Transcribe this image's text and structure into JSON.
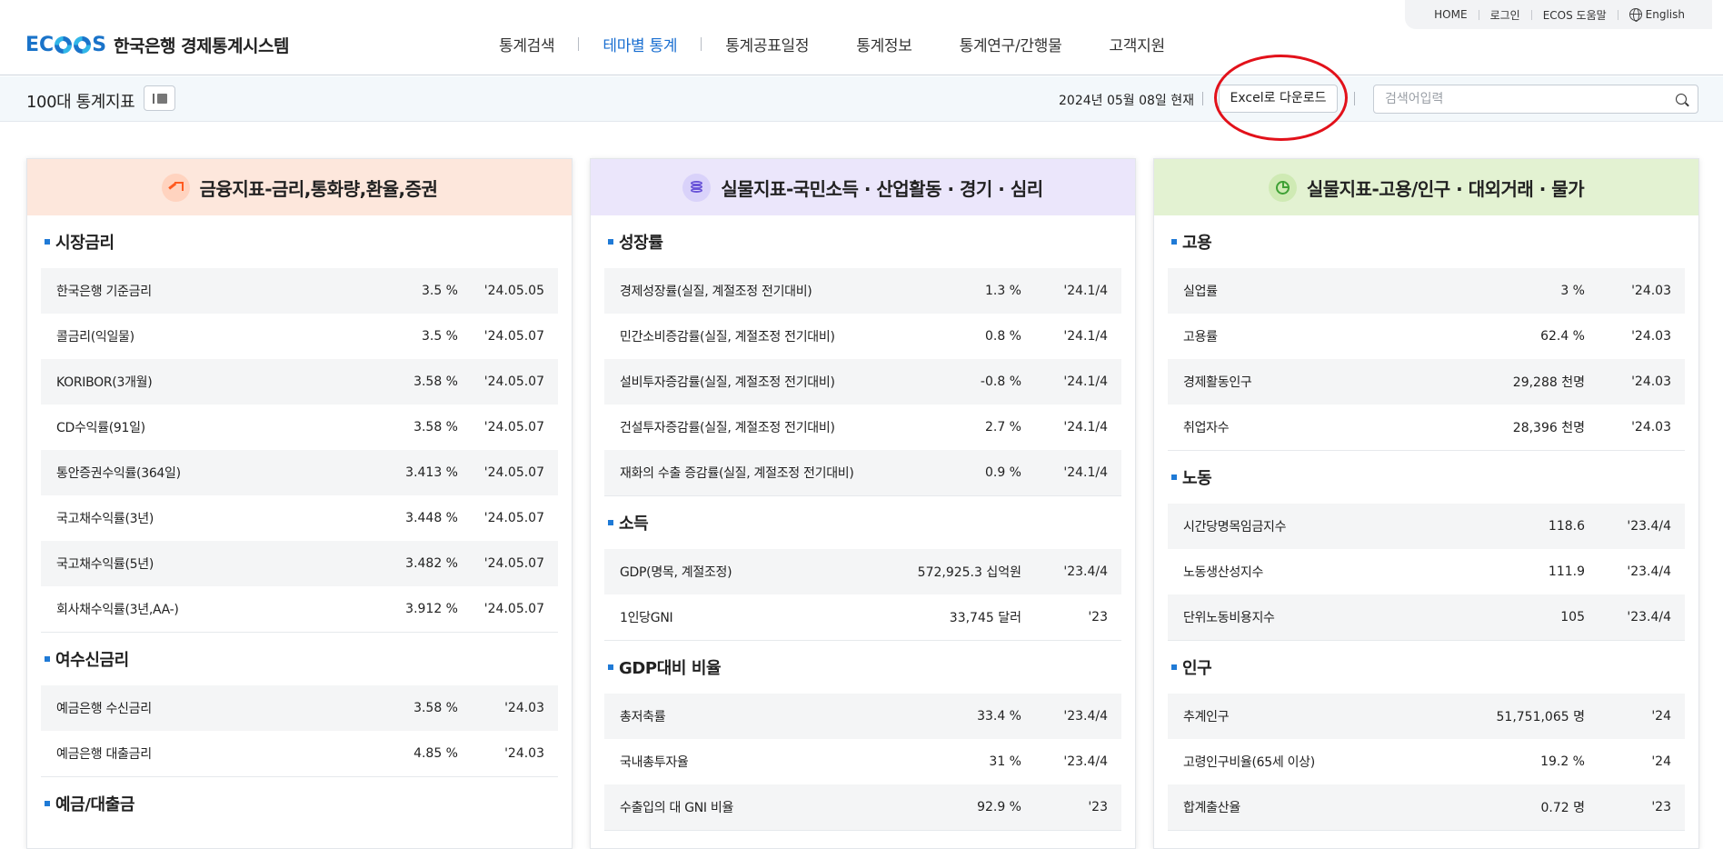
{
  "header": {
    "logo_mark": "ECOS",
    "logo_text": "한국은행 경제통계시스템",
    "util": [
      "HOME",
      "로그인",
      "ECOS 도움말",
      "English"
    ],
    "nav": [
      "통계검색",
      "테마별 통계",
      "통계공표일정",
      "통계정보",
      "통계연구/간행물",
      "고객지원"
    ],
    "active_nav": "테마별 통계"
  },
  "subbar": {
    "title": "100대 통계지표",
    "date": "2024년 05월 08일 현재",
    "excel_label": "Excel로 다운로드",
    "search_placeholder": "검색어입력"
  },
  "colors": {
    "accent": "#1a6fd1",
    "panel1_head": "#fde7dc",
    "panel2_head": "#ebe6fb",
    "panel3_head": "#e3f2d2",
    "highlight_circle": "#e2111a"
  },
  "panels": [
    {
      "title": "금융지표-금리,통화량,환율,증권",
      "icon": "trend-up-icon",
      "sections": [
        {
          "title": "시장금리",
          "rows": [
            {
              "name": "한국은행 기준금리",
              "value": "3.5 %",
              "date": "'24.05.05"
            },
            {
              "name": "콜금리(익일물)",
              "value": "3.5 %",
              "date": "'24.05.07"
            },
            {
              "name": "KORIBOR(3개월)",
              "value": "3.58 %",
              "date": "'24.05.07"
            },
            {
              "name": "CD수익률(91일)",
              "value": "3.58 %",
              "date": "'24.05.07"
            },
            {
              "name": "통안증권수익률(364일)",
              "value": "3.413 %",
              "date": "'24.05.07"
            },
            {
              "name": "국고채수익률(3년)",
              "value": "3.448 %",
              "date": "'24.05.07"
            },
            {
              "name": "국고채수익률(5년)",
              "value": "3.482 %",
              "date": "'24.05.07"
            },
            {
              "name": "회사채수익률(3년,AA-)",
              "value": "3.912 %",
              "date": "'24.05.07"
            }
          ]
        },
        {
          "title": "여수신금리",
          "rows": [
            {
              "name": "예금은행 수신금리",
              "value": "3.58 %",
              "date": "'24.03"
            },
            {
              "name": "예금은행 대출금리",
              "value": "4.85 %",
              "date": "'24.03"
            }
          ]
        },
        {
          "title": "예금/대출금",
          "rows": []
        }
      ]
    },
    {
      "title": "실물지표-국민소득 · 산업활동 · 경기 · 심리",
      "icon": "coins-icon",
      "sections": [
        {
          "title": "성장률",
          "rows": [
            {
              "name": "경제성장률(실질, 계절조정 전기대비)",
              "value": "1.3 %",
              "date": "'24.1/4"
            },
            {
              "name": "민간소비증감률(실질, 계절조정 전기대비)",
              "value": "0.8 %",
              "date": "'24.1/4"
            },
            {
              "name": "설비투자증감률(실질, 계절조정 전기대비)",
              "value": "-0.8 %",
              "date": "'24.1/4"
            },
            {
              "name": "건설투자증감률(실질, 계절조정 전기대비)",
              "value": "2.7 %",
              "date": "'24.1/4"
            },
            {
              "name": "재화의 수출 증감률(실질, 계절조정 전기대비)",
              "value": "0.9 %",
              "date": "'24.1/4"
            }
          ]
        },
        {
          "title": "소득",
          "rows": [
            {
              "name": "GDP(명목, 계절조정)",
              "value": "572,925.3 십억원",
              "date": "'23.4/4"
            },
            {
              "name": "1인당GNI",
              "value": "33,745 달러",
              "date": "'23"
            }
          ]
        },
        {
          "title": "GDP대비 비율",
          "rows": [
            {
              "name": "총저축률",
              "value": "33.4 %",
              "date": "'23.4/4"
            },
            {
              "name": "국내총투자율",
              "value": "31 %",
              "date": "'23.4/4"
            },
            {
              "name": "수출입의 대 GNI 비율",
              "value": "92.9 %",
              "date": "'23"
            }
          ]
        }
      ]
    },
    {
      "title": "실물지표-고용/인구 · 대외거래 · 물가",
      "icon": "pie-chart-icon",
      "sections": [
        {
          "title": "고용",
          "rows": [
            {
              "name": "실업률",
              "value": "3 %",
              "date": "'24.03"
            },
            {
              "name": "고용률",
              "value": "62.4 %",
              "date": "'24.03"
            },
            {
              "name": "경제활동인구",
              "value": "29,288 천명",
              "date": "'24.03"
            },
            {
              "name": "취업자수",
              "value": "28,396 천명",
              "date": "'24.03"
            }
          ]
        },
        {
          "title": "노동",
          "rows": [
            {
              "name": "시간당명목임금지수",
              "value": "118.6",
              "date": "'23.4/4"
            },
            {
              "name": "노동생산성지수",
              "value": "111.9",
              "date": "'23.4/4"
            },
            {
              "name": "단위노동비용지수",
              "value": "105",
              "date": "'23.4/4"
            }
          ]
        },
        {
          "title": "인구",
          "rows": [
            {
              "name": "추계인구",
              "value": "51,751,065 명",
              "date": "'24"
            },
            {
              "name": "고령인구비율(65세 이상)",
              "value": "19.2 %",
              "date": "'24"
            },
            {
              "name": "합계출산율",
              "value": "0.72 명",
              "date": "'23"
            }
          ]
        }
      ]
    }
  ]
}
